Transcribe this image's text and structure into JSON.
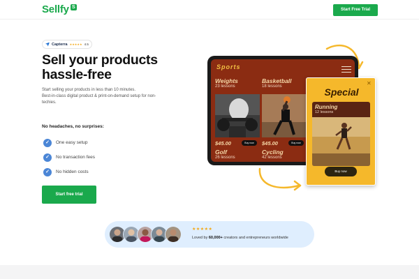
{
  "header": {
    "logo_text": "Sellfy",
    "logo_badge": "S",
    "cta_label": "Start Free Trial"
  },
  "hero": {
    "capterra": {
      "name": "Capterra",
      "stars": "★★★★★",
      "rating": "4.5"
    },
    "title": "Sell your products hassle-free",
    "subtitle_lines": [
      "Start selling your products in less than 10 minutes.",
      "Best-in-class digital product & print-on-demand setup for non-",
      "techies."
    ],
    "features_heading": "No headaches, no surprises:",
    "features": [
      {
        "label": "One easy setup"
      },
      {
        "label": "No transaction fees"
      },
      {
        "label": "No hidden costs"
      }
    ],
    "cta_label": "Start free trial"
  },
  "mockup": {
    "brand": "Sports",
    "courses": [
      {
        "title": "Weights",
        "lessons": "23 lessons",
        "price": "$45.00",
        "buy": "Buy now"
      },
      {
        "title": "Basketball",
        "lessons": "18 lessons",
        "price": "$45.00",
        "buy": "Buy now"
      },
      {
        "title": "Golf",
        "lessons": "26 lessons"
      },
      {
        "title": "Cycling",
        "lessons": "42 lessons"
      }
    ],
    "special": {
      "title": "Special",
      "course_title": "Running",
      "course_lessons": "12 lessons",
      "buy": "Buy now"
    }
  },
  "social_proof": {
    "stars": "★★★★★",
    "text_prefix": "Loved by ",
    "text_count": "60,000+",
    "text_suffix": " creators and entrepreneurs worldwide"
  },
  "colors": {
    "brand_green": "#1aa94c",
    "check_blue": "#4b86d6",
    "accent_yellow": "#f5b82b",
    "tablet_red": "#8b2c12"
  }
}
